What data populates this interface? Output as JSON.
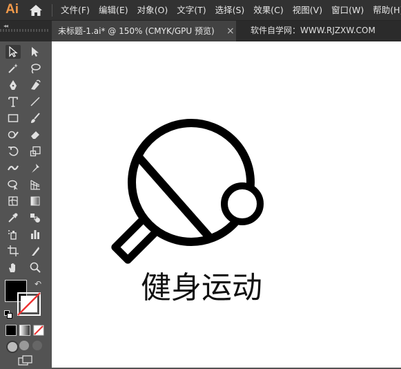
{
  "app": {
    "logo_text": "Ai",
    "menu": [
      "文件(F)",
      "编辑(E)",
      "对象(O)",
      "文字(T)",
      "选择(S)",
      "效果(C)",
      "视图(V)",
      "窗口(W)",
      "帮助(H)"
    ]
  },
  "tabs": {
    "collapse": "◂◂",
    "document_tab": "未标题-1.ai* @ 150% (CMYK/GPU 预览)",
    "close": "×",
    "watermark": "软件自学网：WWW.RJZXW.COM"
  },
  "toolbar": {
    "tools": [
      "selection-tool-icon",
      "direct-selection-tool-icon",
      "magic-wand-tool-icon",
      "lasso-tool-icon",
      "pen-tool-icon",
      "curvature-tool-icon",
      "type-tool-icon",
      "line-segment-tool-icon",
      "rectangle-tool-icon",
      "paintbrush-tool-icon",
      "shaper-tool-icon",
      "eraser-tool-icon",
      "rotate-tool-icon",
      "scale-tool-icon",
      "width-tool-icon",
      "puppet-warp-tool-icon",
      "shape-builder-tool-icon",
      "perspective-grid-tool-icon",
      "mesh-tool-icon",
      "gradient-tool-icon",
      "eyedropper-tool-icon",
      "blend-tool-icon",
      "symbol-sprayer-tool-icon",
      "column-graph-tool-icon",
      "artboard-tool-icon",
      "slice-tool-icon",
      "hand-tool-icon",
      "zoom-tool-icon"
    ],
    "fill_color": "#000000",
    "stroke_color": "none"
  },
  "artwork": {
    "caption": "健身运动",
    "stroke_color": "#000000"
  }
}
